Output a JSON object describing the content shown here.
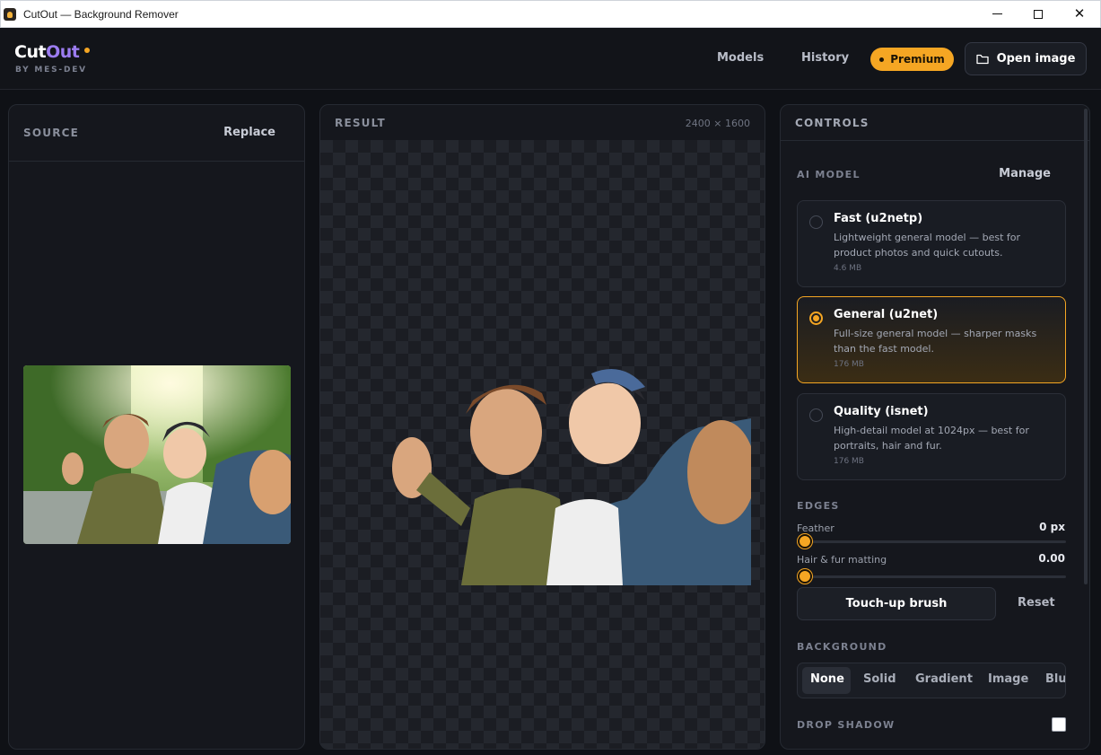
{
  "window": {
    "title": "CutOut — Background Remover"
  },
  "header": {
    "logo_cut": "Cut",
    "logo_out": "Out",
    "logo_sub": "BY MES-DEV",
    "nav": [
      "Models",
      "History"
    ],
    "premium_label": "Premium",
    "open_label": "Open image"
  },
  "source": {
    "label": "SOURCE",
    "replace_label": "Replace"
  },
  "result": {
    "label": "RESULT",
    "dimensions": "2400 × 1600"
  },
  "controls": {
    "label": "CONTROLS",
    "ai_model_label": "AI MODEL",
    "manage_label": "Manage",
    "models": [
      {
        "name": "Fast (u2netp)",
        "desc": "Lightweight general model — best for product photos and quick cutouts.",
        "size": "4.6 MB",
        "selected": false
      },
      {
        "name": "General (u2net)",
        "desc": "Full-size general model — sharper masks than the fast model.",
        "size": "176 MB",
        "selected": true
      },
      {
        "name": "Quality (isnet)",
        "desc": "High-detail model at 1024px — best for portraits, hair and fur.",
        "size": "176 MB",
        "selected": false
      }
    ],
    "edges_label": "EDGES",
    "feather": {
      "label": "Feather",
      "value": "0 px",
      "level": 0
    },
    "hair": {
      "label": "Hair & fur matting",
      "value": "0.00",
      "level": 0
    },
    "touch_up_label": "Touch-up brush",
    "reset_label": "Reset",
    "background_label": "BACKGROUND",
    "background_options": [
      "None",
      "Solid",
      "Gradient",
      "Image",
      "Blur"
    ],
    "background_selected": "None",
    "drop_shadow_label": "DROP SHADOW",
    "drop_shadow_checked": false
  },
  "colors": {
    "accent": "#f5a623",
    "panel": "#15171d",
    "background": "#0f1116"
  }
}
